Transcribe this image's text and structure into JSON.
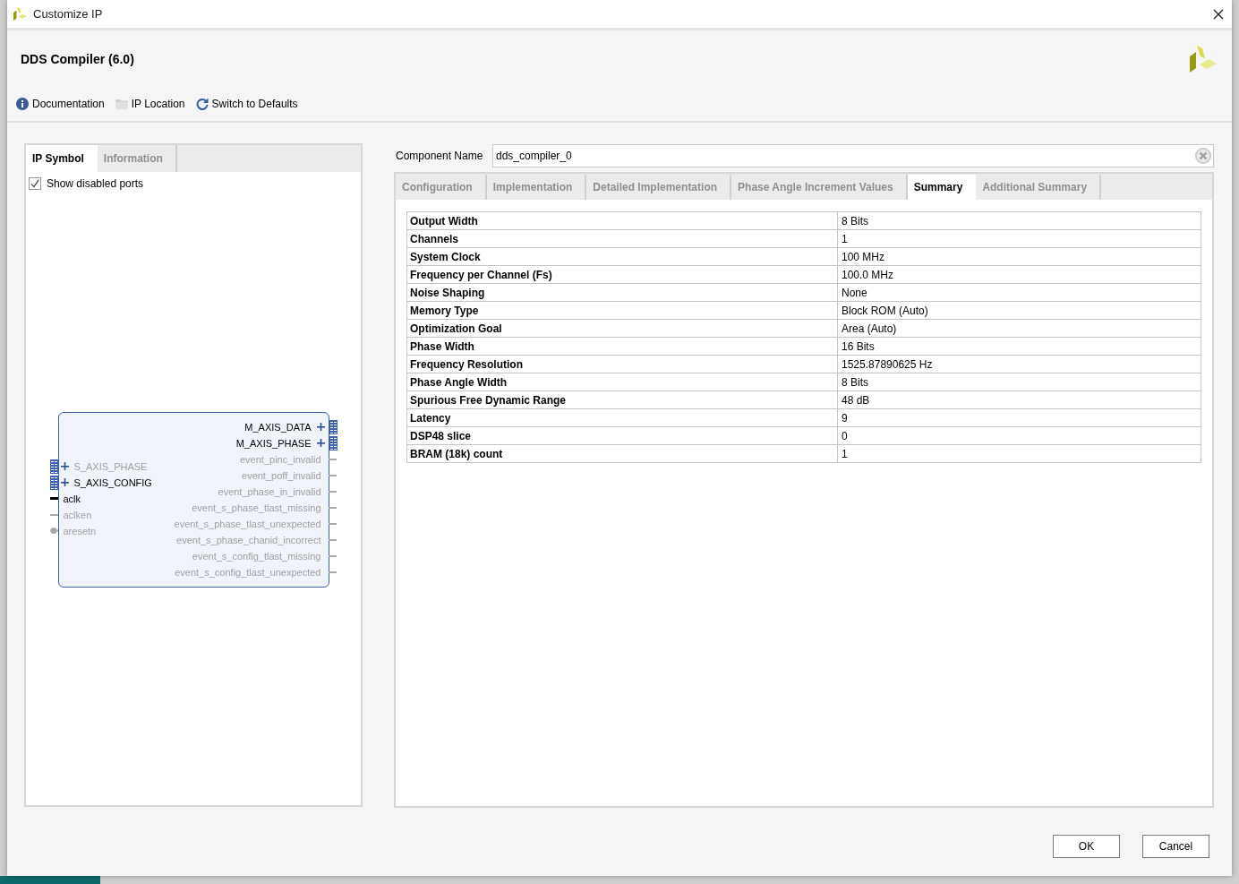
{
  "window": {
    "title": "Customize IP"
  },
  "header": {
    "title": "DDS Compiler (6.0)"
  },
  "toolbar": [
    {
      "label": "Documentation",
      "kind": "info"
    },
    {
      "label": "IP Location",
      "kind": "folder"
    },
    {
      "label": "Switch to Defaults",
      "kind": "reset"
    }
  ],
  "left_panel": {
    "tabs": [
      {
        "label": "IP Symbol",
        "selected": true
      },
      {
        "label": "Information",
        "selected": false
      }
    ],
    "show_disabled_ports": {
      "label": "Show disabled ports",
      "checked": true
    },
    "ip_symbol": {
      "left_ports": [
        {
          "name": "S_AXIS_PHASE",
          "kind": "bus",
          "enabled": false
        },
        {
          "name": "S_AXIS_CONFIG",
          "kind": "bus",
          "enabled": true
        },
        {
          "name": "aclk",
          "kind": "wire",
          "enabled": true
        },
        {
          "name": "aclken",
          "kind": "wire",
          "enabled": false
        },
        {
          "name": "aresetn",
          "kind": "reset",
          "enabled": false
        }
      ],
      "right_ports": [
        {
          "name": "M_AXIS_DATA",
          "kind": "bus",
          "enabled": true
        },
        {
          "name": "M_AXIS_PHASE",
          "kind": "bus",
          "enabled": true
        },
        {
          "name": "event_pinc_invalid",
          "kind": "wire",
          "enabled": false
        },
        {
          "name": "event_poff_invalid",
          "kind": "wire",
          "enabled": false
        },
        {
          "name": "event_phase_in_invalid",
          "kind": "wire",
          "enabled": false
        },
        {
          "name": "event_s_phase_tlast_missing",
          "kind": "wire",
          "enabled": false
        },
        {
          "name": "event_s_phase_tlast_unexpected",
          "kind": "wire",
          "enabled": false
        },
        {
          "name": "event_s_phase_chanid_incorrect",
          "kind": "wire",
          "enabled": false
        },
        {
          "name": "event_s_config_tlast_missing",
          "kind": "wire",
          "enabled": false
        },
        {
          "name": "event_s_config_tlast_unexpected",
          "kind": "wire",
          "enabled": false
        }
      ]
    }
  },
  "component_name": {
    "label": "Component Name",
    "value": "dds_compiler_0"
  },
  "config_tabs": [
    {
      "label": "Configuration",
      "selected": false
    },
    {
      "label": "Implementation",
      "selected": false
    },
    {
      "label": "Detailed Implementation",
      "selected": false
    },
    {
      "label": "Phase Angle Increment Values",
      "selected": false
    },
    {
      "label": "Summary",
      "selected": true
    },
    {
      "label": "Additional Summary",
      "selected": false
    }
  ],
  "summary_table": {
    "rows": [
      {
        "name": "Output Width",
        "value": "8 Bits"
      },
      {
        "name": "Channels",
        "value": "1"
      },
      {
        "name": "System Clock",
        "value": "100 MHz"
      },
      {
        "name": "Frequency per Channel (Fs)",
        "value": "100.0 MHz"
      },
      {
        "name": "Noise Shaping",
        "value": "None"
      },
      {
        "name": "Memory Type",
        "value": "Block ROM (Auto)"
      },
      {
        "name": "Optimization Goal",
        "value": "Area (Auto)"
      },
      {
        "name": "Phase Width",
        "value": "16 Bits"
      },
      {
        "name": "Frequency Resolution",
        "value": "1525.87890625 Hz"
      },
      {
        "name": "Phase Angle Width",
        "value": "8 Bits"
      },
      {
        "name": "Spurious Free Dynamic Range",
        "value": "48 dB"
      },
      {
        "name": "Latency",
        "value": "9"
      },
      {
        "name": "DSP48 slice",
        "value": "0"
      },
      {
        "name": "BRAM (18k) count",
        "value": "1"
      }
    ]
  },
  "buttons": [
    {
      "label": "OK"
    },
    {
      "label": "Cancel"
    }
  ]
}
